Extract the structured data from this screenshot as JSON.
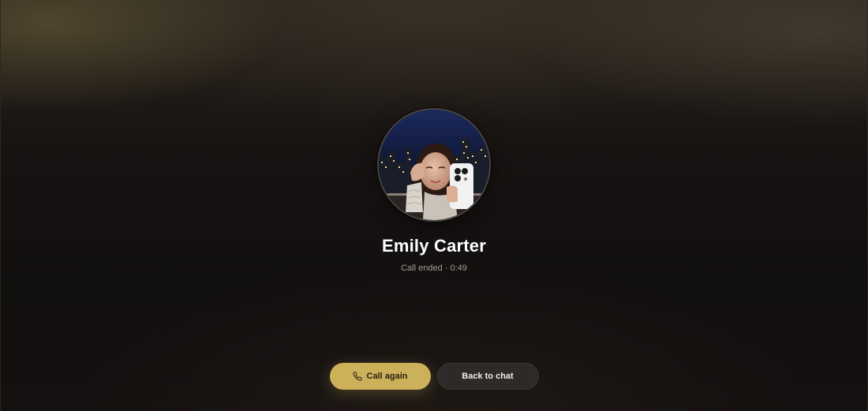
{
  "contact": {
    "name": "Emily Carter",
    "status": "Call ended · 0:49"
  },
  "actions": {
    "call_again_label": "Call again",
    "back_to_chat_label": "Back to chat"
  },
  "icons": {
    "call_again": "phone-icon"
  },
  "colors": {
    "accent": "#cdb05a",
    "secondary_button": "#2e2a28",
    "background": "#141111"
  }
}
